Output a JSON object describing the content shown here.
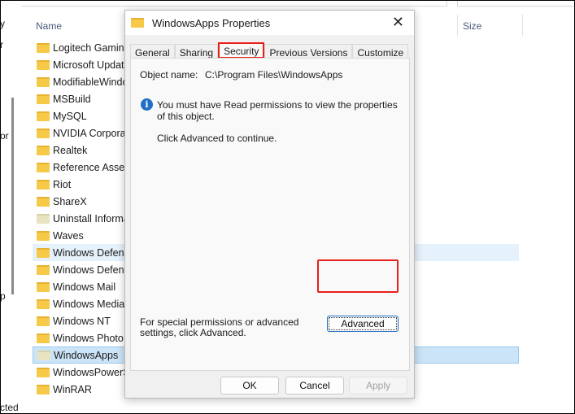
{
  "explorer": {
    "column_name": "Name",
    "column_size": "Size",
    "status": "cted",
    "left_fragments": [
      "y",
      "r",
      "or",
      "p"
    ],
    "rows": [
      {
        "label": "Logitech Gaming",
        "state": ""
      },
      {
        "label": "Microsoft Updat",
        "state": ""
      },
      {
        "label": "ModifiableWindo",
        "state": ""
      },
      {
        "label": "MSBuild",
        "state": ""
      },
      {
        "label": "MySQL",
        "state": ""
      },
      {
        "label": "NVIDIA Corporat",
        "state": ""
      },
      {
        "label": "Realtek",
        "state": ""
      },
      {
        "label": "Reference Assem",
        "state": ""
      },
      {
        "label": "Riot",
        "state": ""
      },
      {
        "label": "ShareX",
        "state": ""
      },
      {
        "label": "Uninstall Informa",
        "state": "dim"
      },
      {
        "label": "Waves",
        "state": ""
      },
      {
        "label": "Windows Defend",
        "state": "hover"
      },
      {
        "label": "Windows Defend",
        "state": ""
      },
      {
        "label": "Windows Mail",
        "state": ""
      },
      {
        "label": "Windows Media",
        "state": ""
      },
      {
        "label": "Windows NT",
        "state": ""
      },
      {
        "label": "Windows Photo",
        "state": ""
      },
      {
        "label": "WindowsApps",
        "state": "sel dim"
      },
      {
        "label": "WindowsPowerS",
        "state": ""
      },
      {
        "label": "WinRAR",
        "state": ""
      }
    ]
  },
  "dialog": {
    "title": "WindowsApps Properties",
    "tabs": [
      "General",
      "Sharing",
      "Security",
      "Previous Versions",
      "Customize"
    ],
    "active_tab": "Security",
    "object_label": "Object name:",
    "object_value": "C:\\Program Files\\WindowsApps",
    "message": "You must have Read permissions to view the properties of this object.",
    "message2": "Click Advanced to continue.",
    "special": "For special permissions or advanced settings, click Advanced.",
    "advanced": "Advanced",
    "ok": "OK",
    "cancel": "Cancel",
    "apply": "Apply"
  },
  "colors": {
    "highlight": "#e8201a",
    "selection": "#cce4f7"
  }
}
